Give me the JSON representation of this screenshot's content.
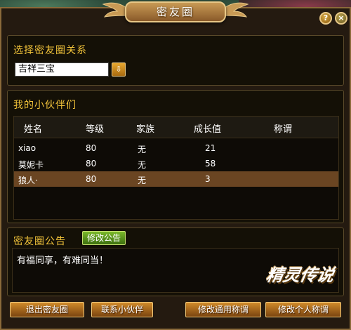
{
  "window": {
    "title": "密友圈",
    "help_label": "?",
    "close_label": "×"
  },
  "relation": {
    "section_title": "选择密友圈关系",
    "selected": "吉祥三宝",
    "arrow_label": "⇩"
  },
  "partners": {
    "section_title": "我的小伙伴们",
    "columns": [
      "姓名",
      "等级",
      "家族",
      "成长值",
      "称谓"
    ],
    "rows": [
      {
        "name": "xiao",
        "level": "80",
        "family": "无",
        "growth": "21",
        "title": ""
      },
      {
        "name": "莫妮卡",
        "level": "80",
        "family": "无",
        "growth": "58",
        "title": ""
      },
      {
        "name": "狼人·",
        "level": "80",
        "family": "无",
        "growth": "3",
        "title": ""
      }
    ],
    "selected_row": 2
  },
  "notice": {
    "section_title": "密友圈公告",
    "edit_label": "修改公告",
    "text": "有福同享，有难同当！",
    "logo_text": "精灵传说"
  },
  "buttons": {
    "leave": "退出密友圈",
    "contact": "联系小伙伴",
    "edit_common_title": "修改通用称谓",
    "edit_personal_title": "修改个人称谓"
  }
}
